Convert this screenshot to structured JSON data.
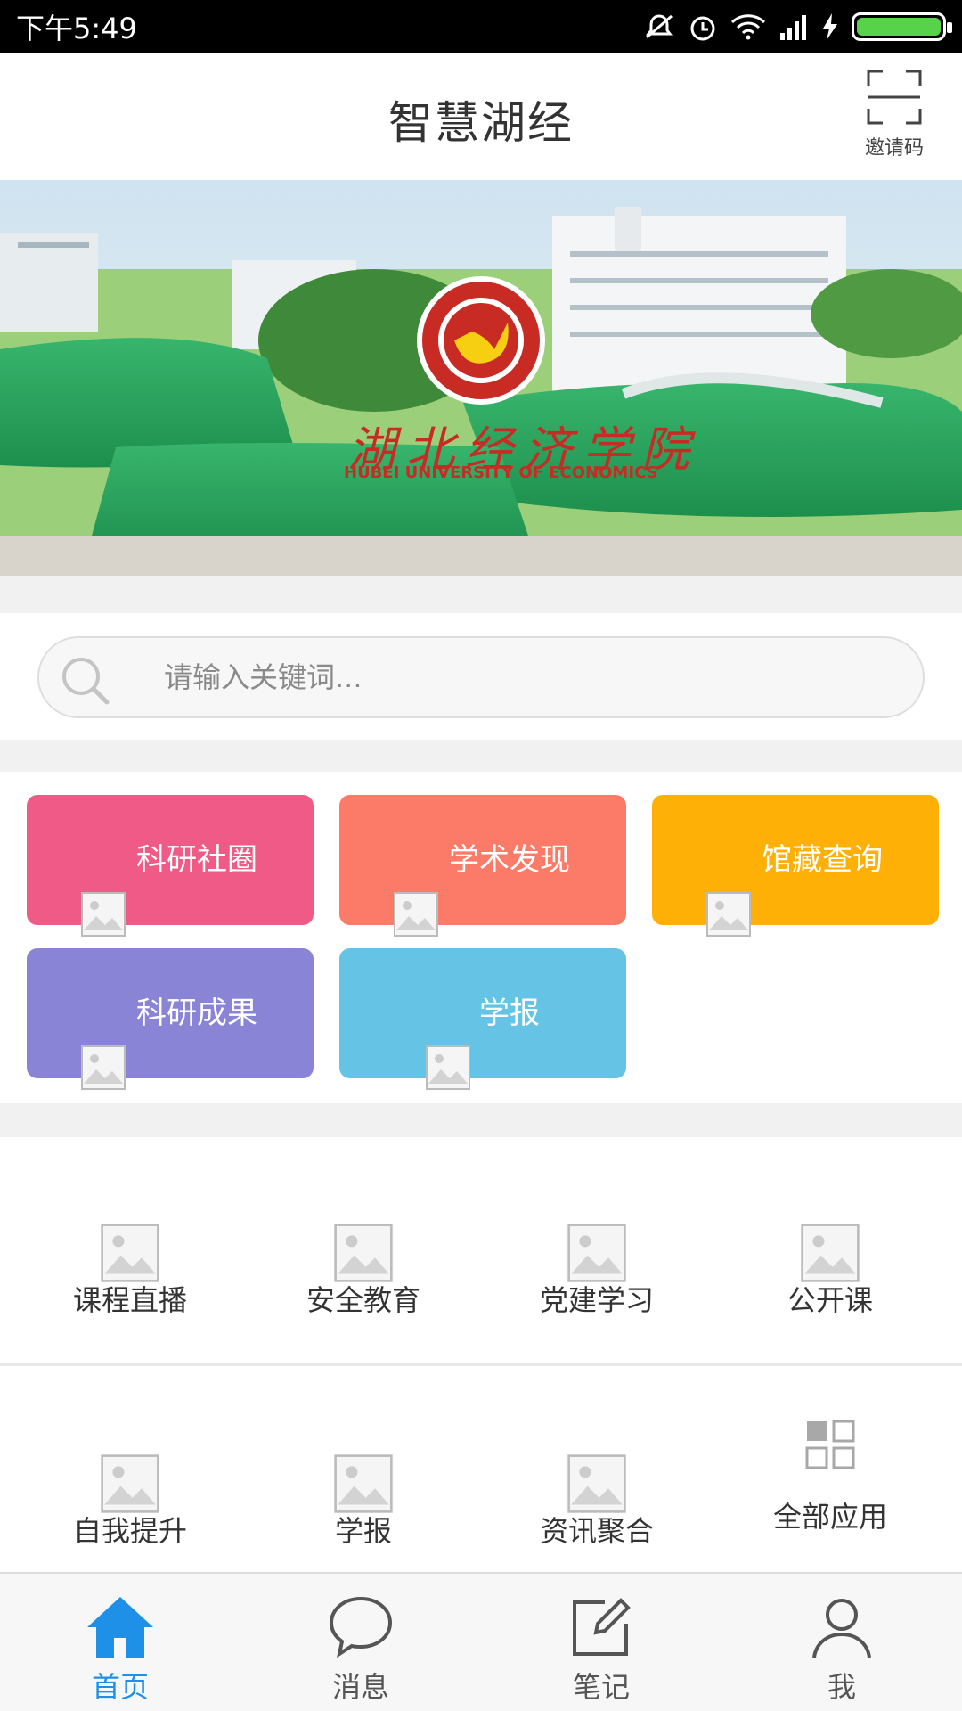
{
  "status_bar": {
    "time": "下午5:49"
  },
  "header": {
    "title": "智慧湖经",
    "invite_label": "邀请码"
  },
  "banner": {
    "school_name_cn": "湖北经济学院",
    "school_name_en": "HUBEI UNIVERSITY OF ECONOMICS"
  },
  "search": {
    "placeholder": "请输入关键词..."
  },
  "cards": [
    {
      "label": "科研社圈",
      "color": "#f05a86"
    },
    {
      "label": "学术发现",
      "color": "#fb7b68"
    },
    {
      "label": "馆藏查询",
      "color": "#feb006"
    },
    {
      "label": "科研成果",
      "color": "#8a84d6"
    },
    {
      "label": "学报",
      "color": "#65c3e5"
    }
  ],
  "grid_row1": [
    {
      "label": "课程直播"
    },
    {
      "label": "安全教育"
    },
    {
      "label": "党建学习"
    },
    {
      "label": "公开课"
    }
  ],
  "grid_row2": [
    {
      "label": "自我提升"
    },
    {
      "label": "学报"
    },
    {
      "label": "资讯聚合"
    },
    {
      "label": "全部应用",
      "icon": "grid-apps-icon"
    }
  ],
  "bottom_nav": [
    {
      "label": "首页",
      "icon": "home-icon",
      "active": true
    },
    {
      "label": "消息",
      "icon": "message-bubble-icon"
    },
    {
      "label": "笔记",
      "icon": "note-edit-icon"
    },
    {
      "label": "我",
      "icon": "user-icon"
    }
  ],
  "colors": {
    "accent": "#1e90e8",
    "battery": "#57d24a"
  }
}
